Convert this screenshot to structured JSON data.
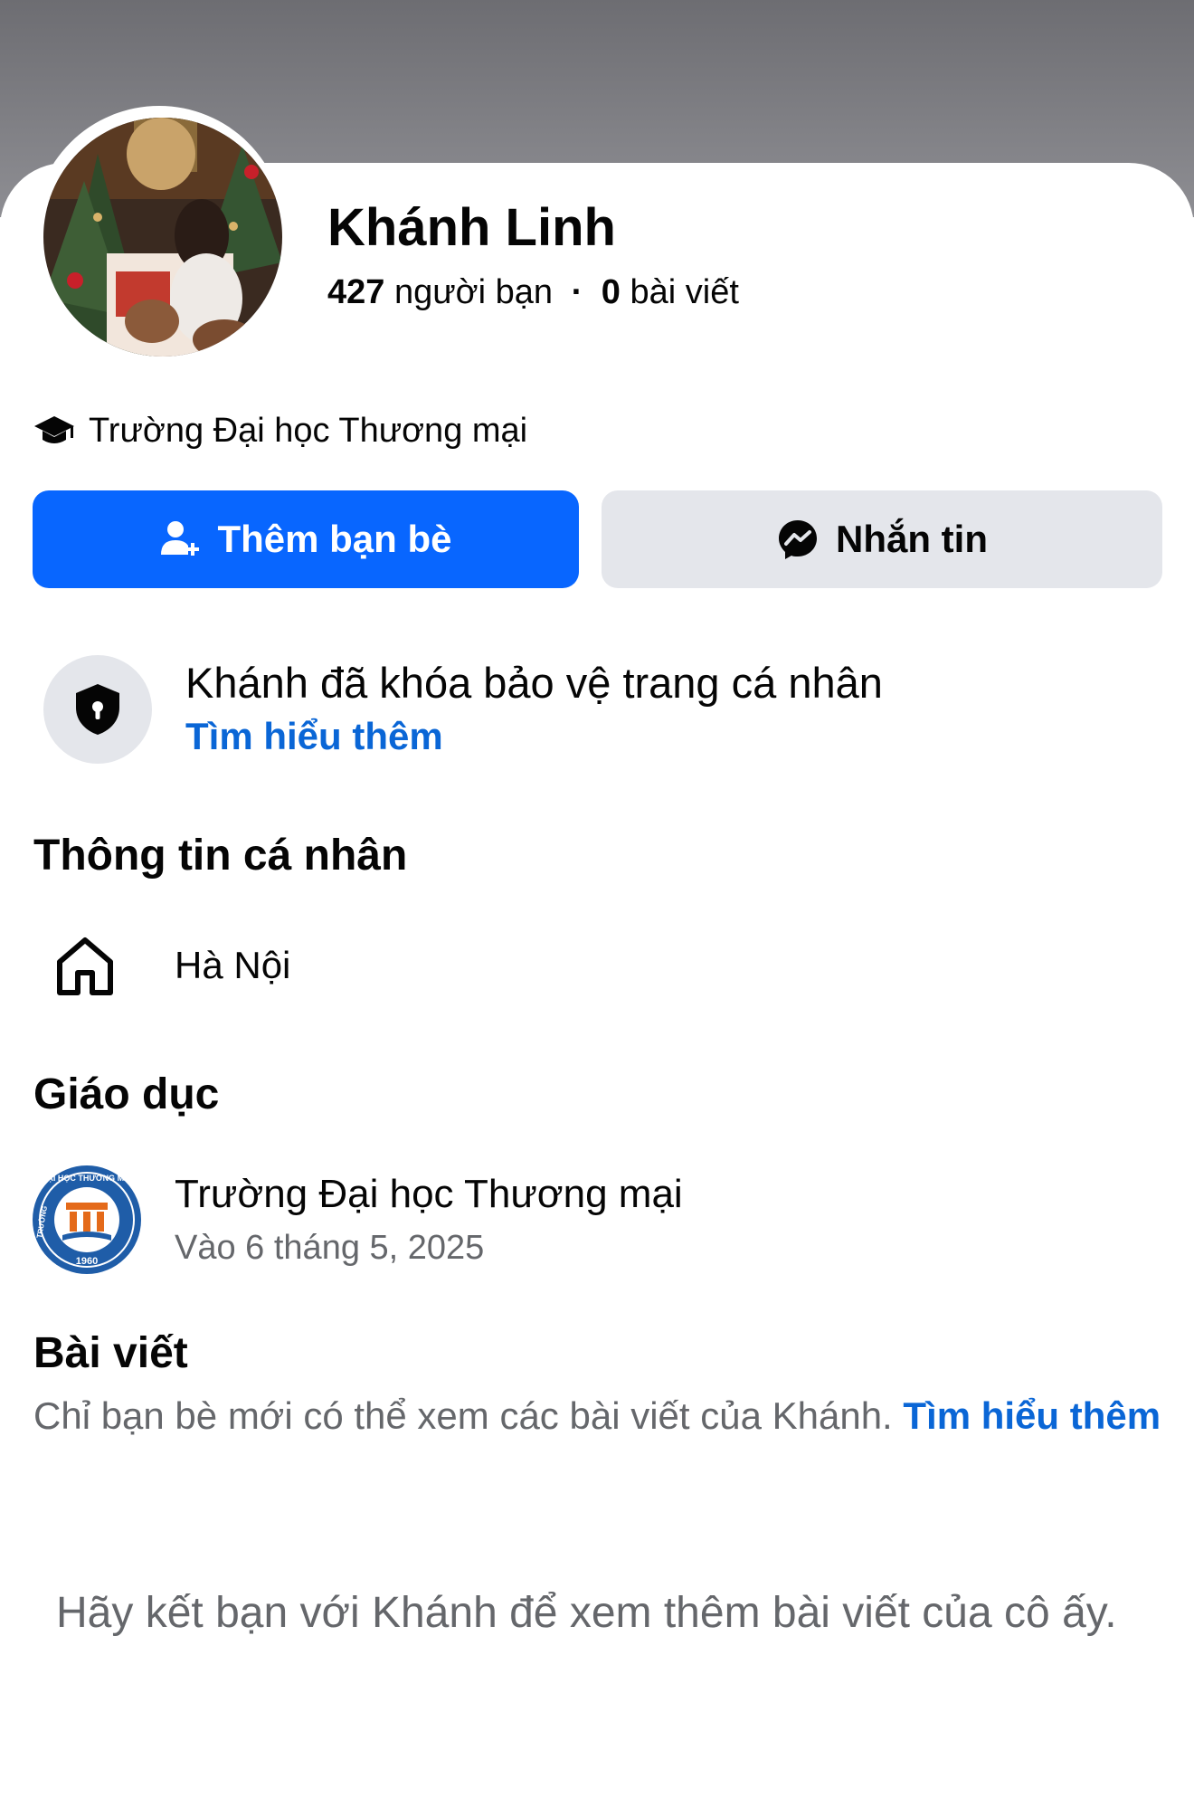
{
  "profile": {
    "name": "Khánh Linh",
    "friends_count": "427",
    "friends_label": "người bạn",
    "separator": "·",
    "posts_count": "0",
    "posts_label": "bài viết",
    "school": "Trường Đại học Thương mại",
    "avatar_icon": "profile-photo"
  },
  "actions": {
    "add_friend_label": "Thêm bạn bè",
    "add_friend_icon": "add-friend-icon",
    "message_label": "Nhắn tin",
    "message_icon": "messenger-icon",
    "primary_color": "#0866ff",
    "secondary_color": "#e4e6eb"
  },
  "lock": {
    "text": "Khánh đã khóa bảo vệ trang cá nhân",
    "link": "Tìm hiểu thêm",
    "icon": "shield-lock-icon"
  },
  "about": {
    "title": "Thông tin cá nhân",
    "hometown": "Hà Nội",
    "hometown_icon": "home-icon"
  },
  "education": {
    "title": "Giáo dục",
    "school": "Trường Đại học Thương mại",
    "date": "Vào 6 tháng 5, 2025",
    "logo_icon": "university-logo",
    "logo_text_top": "ĐẠI HỌC THƯƠNG MẠI",
    "logo_text_left": "TRƯỜNG",
    "logo_year": "1960"
  },
  "posts": {
    "title": "Bài viết",
    "description": "Chỉ bạn bè mới có thể xem các bài viết của Khánh.",
    "link": "Tìm hiểu thêm",
    "friend_prompt": "Hãy kết bạn với Khánh để xem thêm bài viết của cô ấy."
  },
  "colors": {
    "link": "#0a66d6",
    "secondary_text": "#65676b"
  }
}
